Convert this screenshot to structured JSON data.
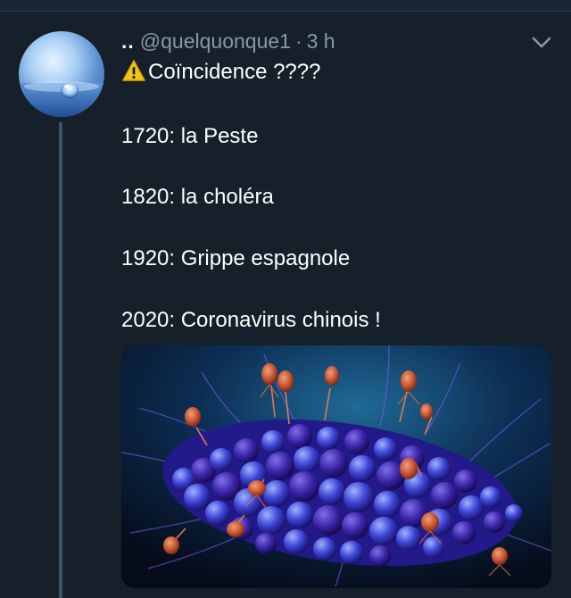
{
  "tweet": {
    "leading_dots": "..",
    "handle": "@quelquonque1",
    "separator": "·",
    "time": "3 h",
    "title_line": "Coïncidence ????",
    "lines": [
      "1720: la Peste",
      "1820: la choléra",
      "1920: Grippe espagnole",
      "2020: Coronavirus chinois !"
    ]
  },
  "icons": {
    "warning": "warning-icon",
    "chevron": "chevron-down-icon"
  },
  "colors": {
    "background": "#15202b",
    "secondary_text": "#8899a6",
    "thread_line": "#3d5466",
    "warning": "#f5c518"
  }
}
